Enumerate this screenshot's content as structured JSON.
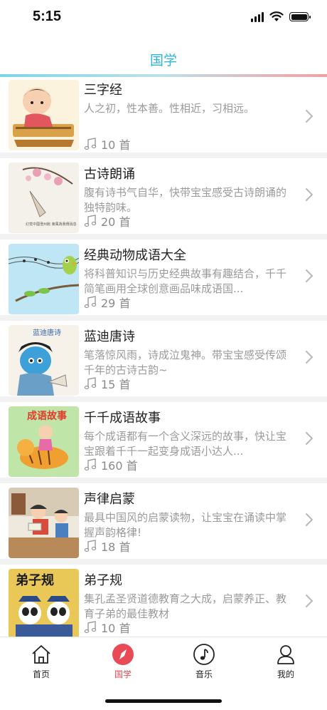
{
  "status_bar": {
    "time": "5:15"
  },
  "nav": {
    "title": "国学"
  },
  "items": [
    {
      "title": "三字经",
      "desc": "人之初，性本善。性相近，习相远。",
      "count": "10 首"
    },
    {
      "title": "古诗朗诵",
      "desc": "腹有诗书气自华，快带宝宝感受古诗朗诵的独特韵味。",
      "count": "20 首"
    },
    {
      "title": "经典动物成语大全",
      "desc": "将科普知识与历史经典故事有趣结合，千千简笔画用全球创意画品味成语国...",
      "count": "29 首"
    },
    {
      "title": "蓝迪唐诗",
      "desc": "笔落惊风雨，诗成泣鬼神。带宝宝感受传颂千年的古诗古韵~",
      "count": "15 首"
    },
    {
      "title": "千千成语故事",
      "desc": "每个成语都有一个含义深远的故事，快让宝宝跟着千千一起变身成语小达人...",
      "count": "160 首"
    },
    {
      "title": "声律启蒙",
      "desc": "最具中国风的启蒙读物，让宝宝在诵读中掌握声韵格律!",
      "count": "18 首"
    },
    {
      "title": "弟子规",
      "desc": "集孔孟圣贤道德教育之大成，启蒙养正、教育子弟的最佳教材",
      "count": "10 首"
    }
  ],
  "thumb_text": {
    "t2": "幻觉中國澄州館 東風為我傳消息",
    "t4": "蓝迪唐诗",
    "t5": "成语故事",
    "t7": "弟子规"
  },
  "tabs": [
    {
      "label": "首页",
      "icon": "home-icon"
    },
    {
      "label": "国学",
      "icon": "compass-icon",
      "active": true
    },
    {
      "label": "音乐",
      "icon": "music-note-icon"
    },
    {
      "label": "我的",
      "icon": "person-icon"
    }
  ],
  "colors": {
    "accent": "#2fb4d8",
    "active_tab": "#e84a56"
  }
}
